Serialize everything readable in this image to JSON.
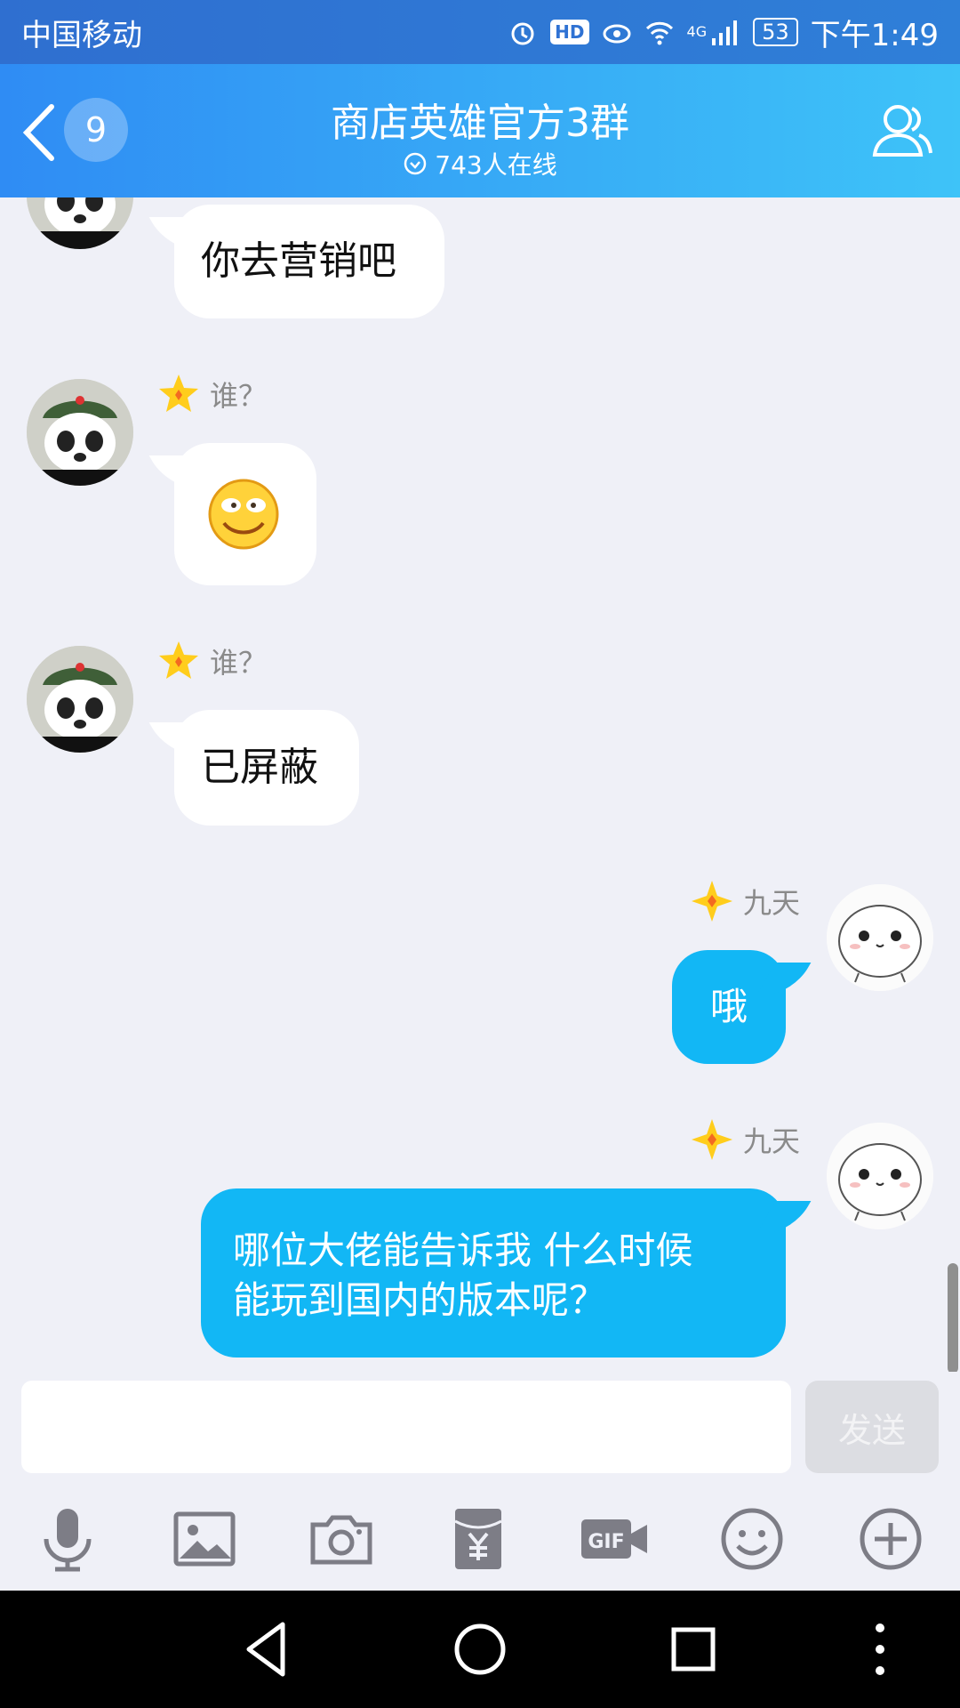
{
  "status_bar": {
    "carrier": "中国移动",
    "hd": "HD",
    "network": "4G",
    "battery": "53",
    "time": "下午1:49"
  },
  "header": {
    "unread_count": "9",
    "title": "商店英雄官方3群",
    "online": "743人在线"
  },
  "messages": [
    {
      "side": "left",
      "sender": "",
      "text": "你去营销吧"
    },
    {
      "side": "left",
      "sender": "谁？",
      "emoji": "grin-emoji"
    },
    {
      "side": "left",
      "sender": "谁？",
      "text": "已屏蔽"
    },
    {
      "side": "right",
      "sender": "九天",
      "text": "哦"
    },
    {
      "side": "right",
      "sender": "九天",
      "text_line1": "哪位大佬能告诉我 什么时候",
      "text_line2": "能玩到国内的版本呢？"
    }
  ],
  "composer": {
    "value": "",
    "send_label": "发送"
  },
  "toolbar": [
    "mic-icon",
    "image-icon",
    "camera-icon",
    "red-packet-icon",
    "gif-icon",
    "emoji-icon",
    "plus-icon"
  ],
  "nav": [
    "back-triangle-icon",
    "home-circle-icon",
    "recents-square-icon",
    "more-dots-icon"
  ],
  "colors": {
    "header_start": "#2f8cf4",
    "header_end": "#3ec3f8",
    "outgoing_bubble": "#12b7f5",
    "background": "#eff0f7"
  }
}
